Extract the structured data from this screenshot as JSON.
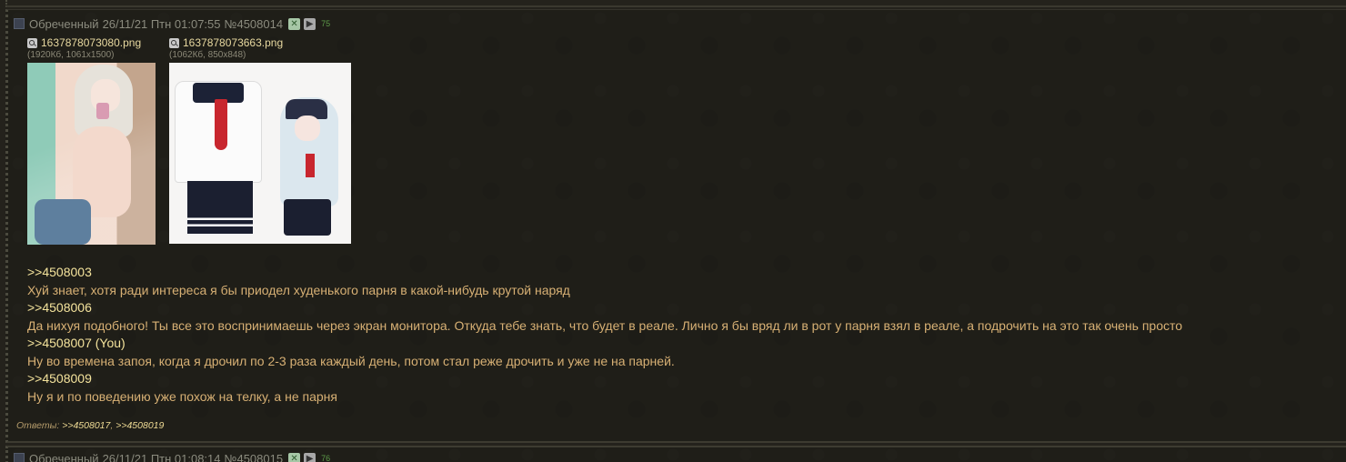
{
  "post": {
    "author": "Обреченный",
    "datetime": "26/11/21 Птн 01:07:55",
    "number": "№4508014",
    "counter": "75",
    "files": [
      {
        "name": "1637878073080.png",
        "meta": "(1920Кб, 1061x1500)"
      },
      {
        "name": "1637878073663.png",
        "meta": "(1062Кб, 850x848)"
      }
    ],
    "lines": [
      {
        "kind": "link",
        "text": ">>4508003"
      },
      {
        "kind": "text",
        "text": "Хуй знает, хотя ради интереса я бы приодел худенького парня в какой-нибудь крутой наряд"
      },
      {
        "kind": "link",
        "text": ">>4508006"
      },
      {
        "kind": "text",
        "text": "Да нихуя подобного! Ты все это воспринимаешь через экран монитора. Откуда тебе знать, что будет в реале. Лично я бы вряд ли в рот у парня взял в реале, а подрочить на это так очень просто"
      },
      {
        "kind": "link",
        "text": ">>4508007 (You)"
      },
      {
        "kind": "text",
        "text": "Ну во времена запоя, когда я дрочил по 2-3 раза каждый день, потом стал реже дрочить и уже не на парней."
      },
      {
        "kind": "link",
        "text": ">>4508009"
      },
      {
        "kind": "text",
        "text": "Ну я и по поведению уже похож на телку, а не парня"
      }
    ],
    "replies": {
      "label": "Ответы:",
      "refs": [
        ">>4508017",
        ">>4508019"
      ],
      "separator": ", "
    }
  },
  "next_post": {
    "author": "Обреченный",
    "datetime": "26/11/21 Птн 01:08:14",
    "number": "№4508015",
    "counter": "76"
  },
  "icons": {
    "hide": "hide-icon",
    "play": "play-icon",
    "magnifier": "magnifier-icon"
  },
  "colors": {
    "link": "#f4e39c",
    "text": "#d7b074",
    "header": "#8b8b7e",
    "counter": "#5d9a49"
  }
}
